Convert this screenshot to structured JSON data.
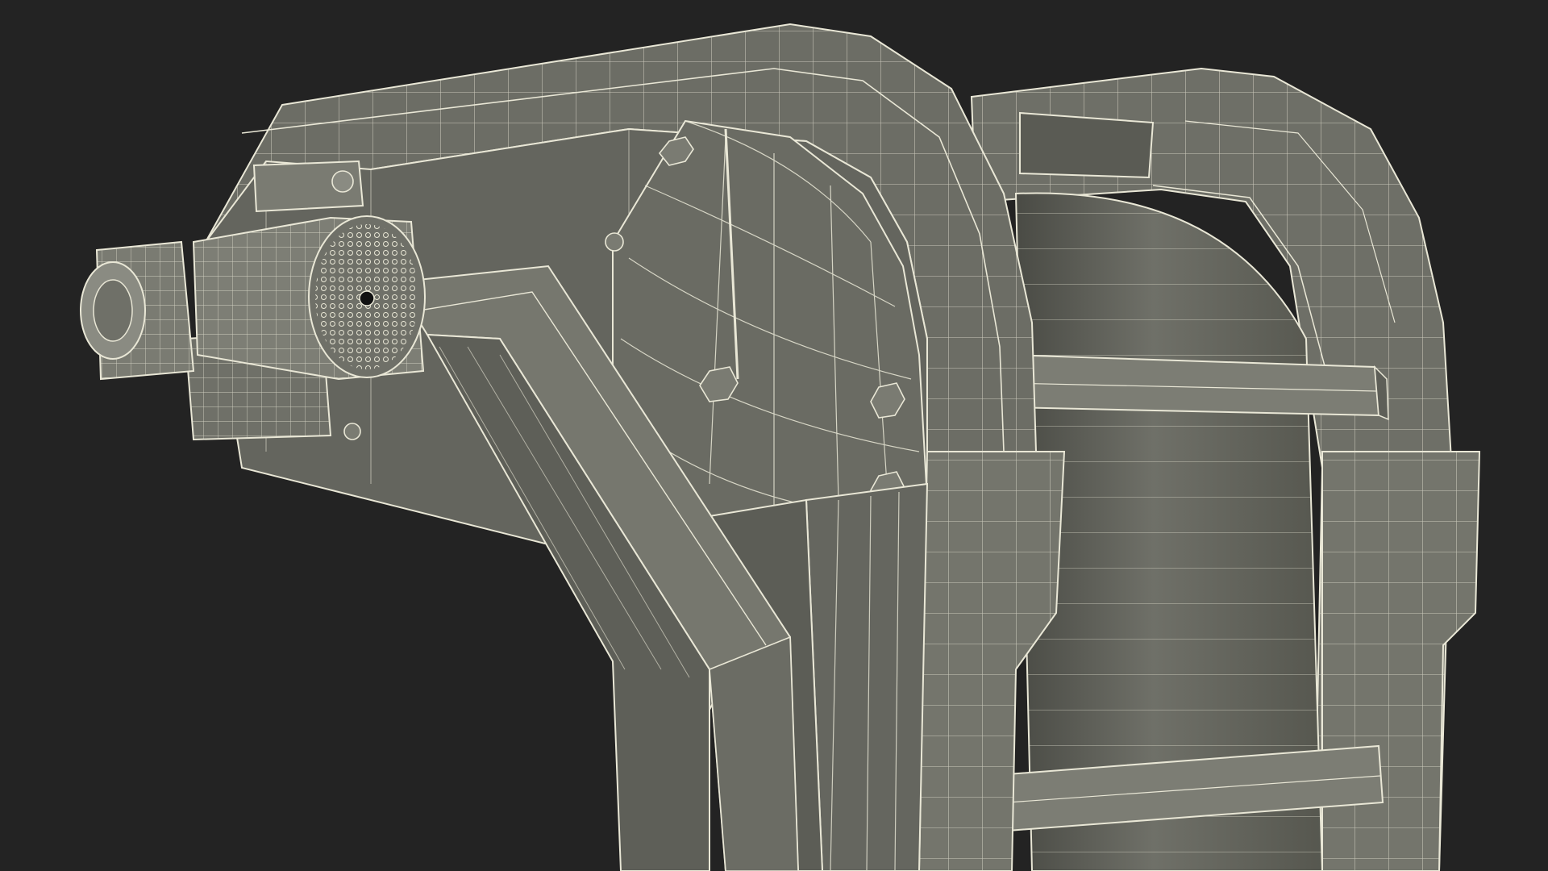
{
  "scene": {
    "background_color": "#232323",
    "surface_color": "#6e6f67",
    "surface_shadow_color": "#4b4c46",
    "surface_light_color": "#8a8b82",
    "wire_color": "#e9e7d6",
    "subject": "wireframe-render-of-conveyor-drive-head"
  }
}
